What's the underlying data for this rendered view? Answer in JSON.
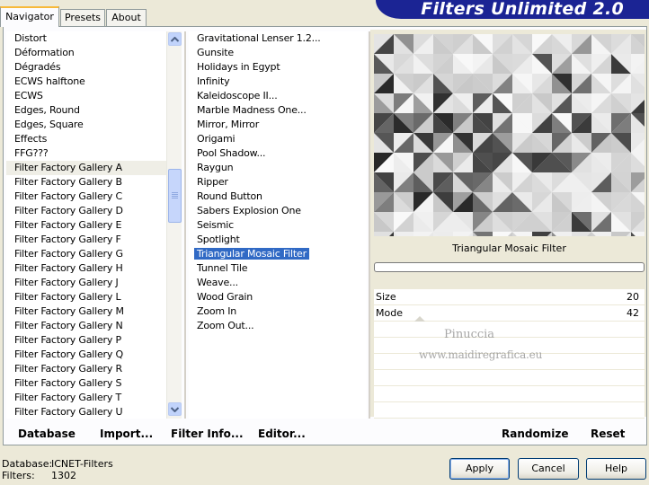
{
  "tabs": [
    {
      "label": "Navigator",
      "active": true
    },
    {
      "label": "Presets",
      "active": false
    },
    {
      "label": "About",
      "active": false
    }
  ],
  "app_title": "Filters Unlimited 2.0",
  "categories": [
    "Distort",
    "Déformation",
    "Dégradés",
    "ECWS halftone",
    "ECWS",
    "Edges, Round",
    "Edges, Square",
    "Effects",
    "FFG???",
    "Filter Factory Gallery A",
    "Filter Factory Gallery B",
    "Filter Factory Gallery C",
    "Filter Factory Gallery D",
    "Filter Factory Gallery E",
    "Filter Factory Gallery F",
    "Filter Factory Gallery G",
    "Filter Factory Gallery H",
    "Filter Factory Gallery J",
    "Filter Factory Gallery L",
    "Filter Factory Gallery M",
    "Filter Factory Gallery N",
    "Filter Factory Gallery P",
    "Filter Factory Gallery Q",
    "Filter Factory Gallery R",
    "Filter Factory Gallery S",
    "Filter Factory Gallery T",
    "Filter Factory Gallery U"
  ],
  "selected_category": "Filter Factory Gallery A",
  "filters": [
    "Gravitational Lenser 1.2...",
    "Gunsite",
    "Holidays in Egypt",
    "Infinity",
    "Kaleidoscope II...",
    "Marble Madness One...",
    "Mirror, Mirror",
    "Origami",
    "Pool Shadow...",
    "Raygun",
    "Ripper",
    "Round Button",
    "Sabers Explosion One",
    "Seismic",
    "Spotlight",
    "Triangular Mosaic Filter",
    "Tunnel Tile",
    "Weave...",
    "Wood Grain",
    "Zoom In",
    "Zoom Out..."
  ],
  "selected_filter": "Triangular Mosaic Filter",
  "preview": {
    "filter_name": "Triangular Mosaic Filter"
  },
  "params": [
    {
      "label": "Size",
      "value": "20"
    },
    {
      "label": "Mode",
      "value": "42"
    }
  ],
  "watermark": {
    "line1": "Pinuccia",
    "line2": "www.maidiregrafica.eu"
  },
  "toolbar": {
    "database": "Database",
    "import": "Import...",
    "filter_info": "Filter Info...",
    "editor": "Editor...",
    "randomize": "Randomize",
    "reset": "Reset"
  },
  "status": {
    "database_label": "Database:",
    "database_value": "ICNET-Filters",
    "filters_label": "Filters:",
    "filters_value": "1302"
  },
  "buttons": {
    "apply": "Apply",
    "cancel": "Cancel",
    "help": "Help"
  }
}
